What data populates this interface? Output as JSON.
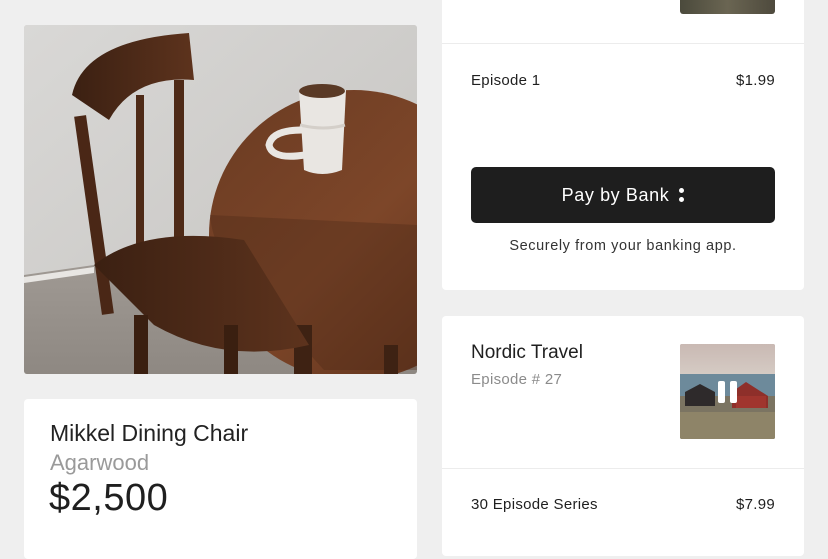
{
  "product": {
    "title": "Mikkel Dining Chair",
    "material": "Agarwood",
    "price": "$2,500",
    "image_icon": "chair-table-photo"
  },
  "payment": {
    "item_label": "Episode 1",
    "item_price": "$1.99",
    "button_label": "Pay by Bank",
    "button_icon": "bank-dots-icon",
    "note": "Securely from your banking app."
  },
  "episode": {
    "title": "Nordic Travel",
    "subtitle": "Episode # 27",
    "thumbnail_icon": "pause-icon",
    "series_label": "30 Episode Series",
    "series_price": "$7.99"
  },
  "colors": {
    "background": "#efefef",
    "card": "#ffffff",
    "button": "#1e1e1e",
    "muted_text": "#9a9a9a"
  }
}
